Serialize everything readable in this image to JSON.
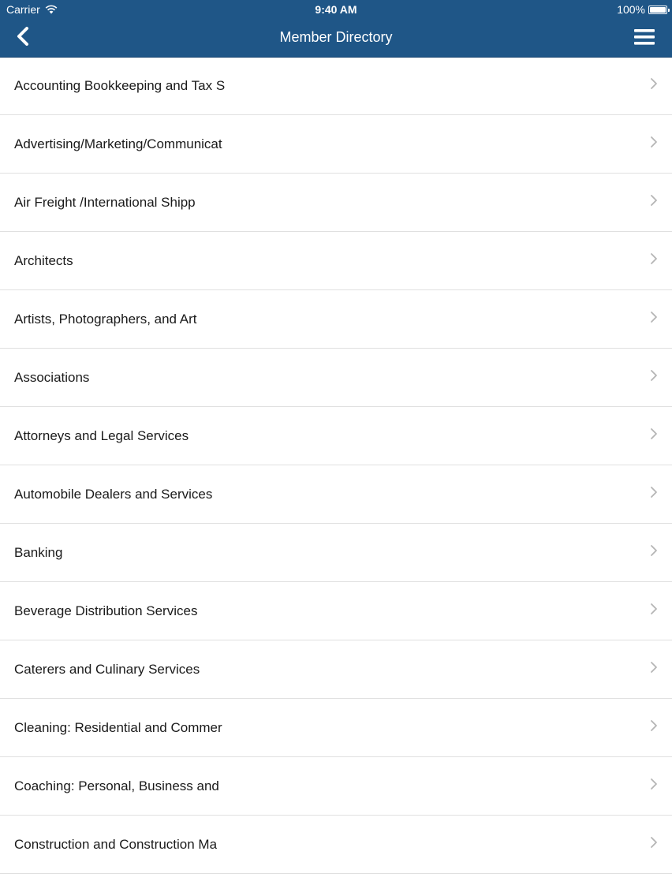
{
  "status_bar": {
    "carrier": "Carrier",
    "time": "9:40 AM",
    "battery": "100%",
    "battery_level": 1.0
  },
  "header": {
    "title": "Member Directory",
    "back_icon": "chevron-left-icon",
    "menu_icon": "hamburger-menu-icon",
    "color": "#1f5687"
  },
  "categories": [
    {
      "label": "Accounting Bookkeeping and Tax S"
    },
    {
      "label": "Advertising/Marketing/Communicat"
    },
    {
      "label": "Air Freight /International Shipp"
    },
    {
      "label": "Architects"
    },
    {
      "label": "Artists, Photographers, and Art"
    },
    {
      "label": "Associations"
    },
    {
      "label": "Attorneys and Legal Services"
    },
    {
      "label": "Automobile Dealers and Services"
    },
    {
      "label": "Banking"
    },
    {
      "label": "Beverage Distribution Services"
    },
    {
      "label": "Caterers and Culinary Services"
    },
    {
      "label": "Cleaning: Residential and Commer"
    },
    {
      "label": "Coaching: Personal, Business and"
    },
    {
      "label": "Construction and Construction Ma"
    }
  ]
}
